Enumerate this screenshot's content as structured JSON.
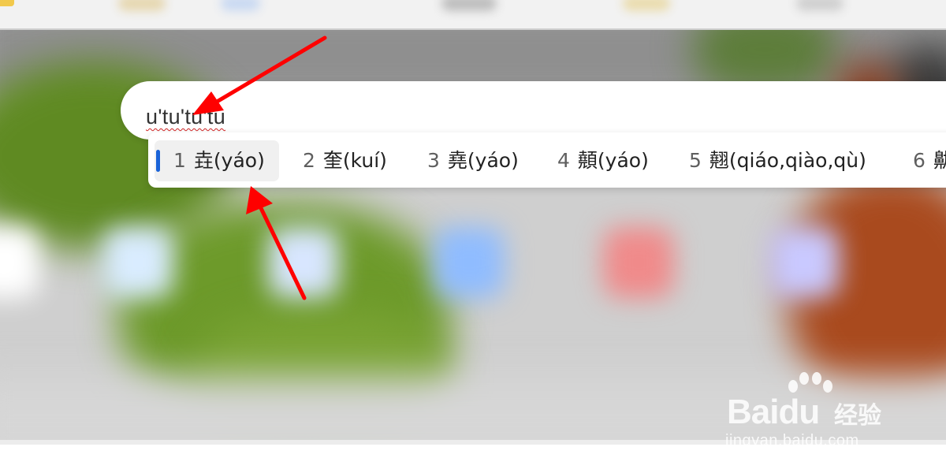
{
  "ime": {
    "composition": "u'tu'tu'tu"
  },
  "candidates": [
    {
      "index": "1",
      "text": "垚(yáo)",
      "selected": true
    },
    {
      "index": "2",
      "text": "奎(kuí)",
      "selected": false
    },
    {
      "index": "3",
      "text": "堯(yáo)",
      "selected": false
    },
    {
      "index": "4",
      "text": "顤(yáo)",
      "selected": false
    },
    {
      "index": "5",
      "text": "翹(qiáo,qiào,qù)",
      "selected": false
    },
    {
      "index": "6",
      "text": "鼽",
      "selected": false
    }
  ],
  "watermark": {
    "brand": "Baidu",
    "brand_cn": "经验",
    "url": "jingyan.baidu.com"
  },
  "colors": {
    "selection_accent": "#1a63d8",
    "annotation_arrow": "#ff0000",
    "spellcheck_underline": "#d02525"
  }
}
